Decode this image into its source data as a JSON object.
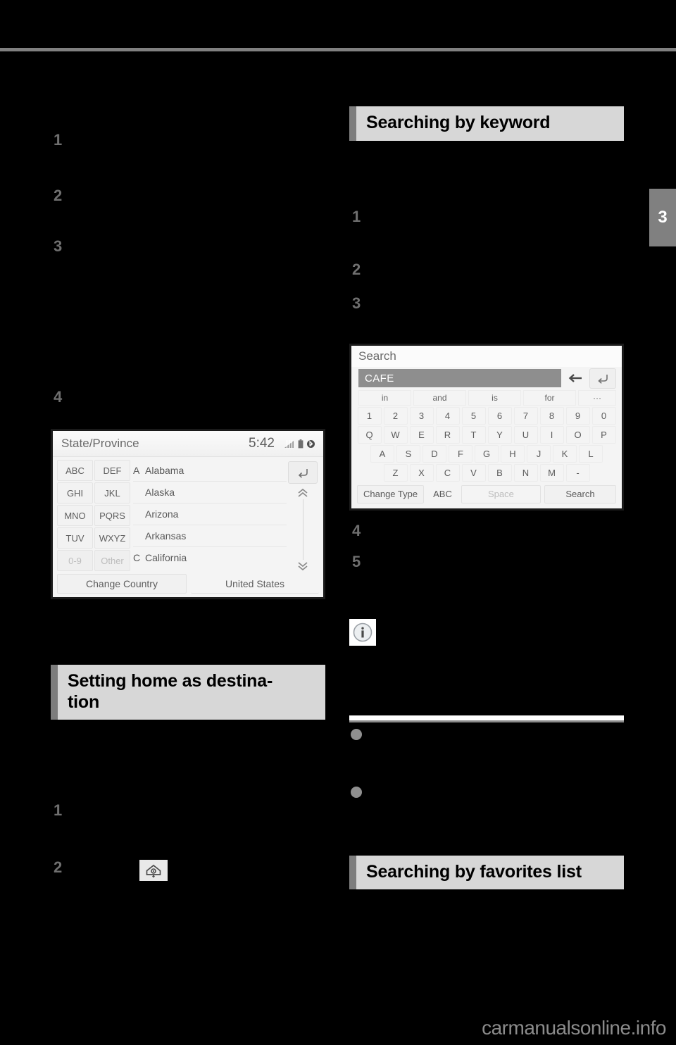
{
  "page": {
    "tab_number": "3",
    "watermark": "carmanualsonline.info"
  },
  "left_column": {
    "steps_top": [
      "1",
      "2",
      "3",
      "4"
    ],
    "heading": "Setting home as destina-tion",
    "heading_line1": "Setting home as destina-",
    "heading_line2": "tion",
    "steps_bottom": [
      "1",
      "2"
    ],
    "home_icon": "home-destination-icon"
  },
  "right_column": {
    "heading_keyword": "Searching by keyword",
    "heading_favorites": "Searching by favorites list",
    "steps_upper": [
      "1",
      "2",
      "3"
    ],
    "steps_lower": [
      "4",
      "5"
    ],
    "info_icon": "information-icon",
    "bullets": [
      "bullet-1",
      "bullet-2"
    ]
  },
  "state_screen": {
    "title": "State/Province",
    "clock": "5:42",
    "status_icons": [
      "signal-icon",
      "battery-icon",
      "bluetooth-icon"
    ],
    "keypad": [
      "ABC",
      "DEF",
      "GHI",
      "JKL",
      "MNO",
      "PQRS",
      "TUV",
      "WXYZ",
      "0-9",
      "Other"
    ],
    "keypad_dim": [
      "0-9",
      "Other"
    ],
    "list": [
      {
        "letter": "A",
        "name": "Alabama"
      },
      {
        "letter": "",
        "name": "Alaska"
      },
      {
        "letter": "",
        "name": "Arizona"
      },
      {
        "letter": "",
        "name": "Arkansas"
      },
      {
        "letter": "C",
        "name": "California"
      }
    ],
    "back_button": "back-arrow-icon",
    "scroll_up": "chevron-up-icon",
    "scroll_down": "chevron-down-icon",
    "footer_change_country": "Change Country",
    "footer_country": "United States"
  },
  "search_screen": {
    "title": "Search",
    "input_value": "CAFE",
    "backspace": "backspace-arrow-icon",
    "enter": "enter-return-icon",
    "suggestions": [
      "in",
      "and",
      "is",
      "for"
    ],
    "suggestion_more": "···",
    "row_numbers": [
      "1",
      "2",
      "3",
      "4",
      "5",
      "6",
      "7",
      "8",
      "9",
      "0"
    ],
    "row_q": [
      "Q",
      "W",
      "E",
      "R",
      "T",
      "Y",
      "U",
      "I",
      "O",
      "P"
    ],
    "row_a": [
      "A",
      "S",
      "D",
      "F",
      "G",
      "H",
      "J",
      "K",
      "L"
    ],
    "row_z": [
      "Z",
      "X",
      "C",
      "V",
      "B",
      "N",
      "M",
      "-"
    ],
    "change_type": "Change Type",
    "abc": "ABC",
    "space": "Space",
    "search": "Search"
  }
}
